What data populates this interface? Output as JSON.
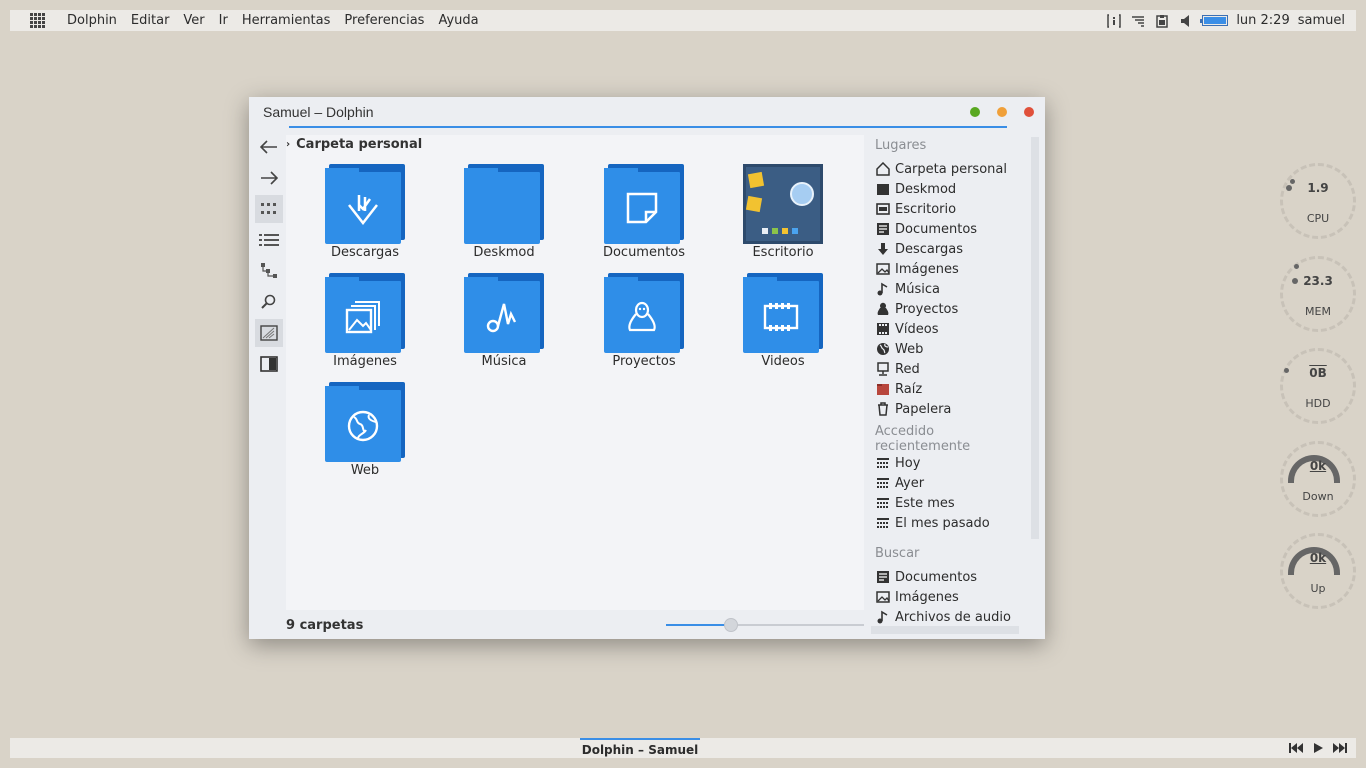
{
  "top_panel": {
    "menu": [
      "Dolphin",
      "Editar",
      "Ver",
      "Ir",
      "Herramientas",
      "Preferencias",
      "Ayuda"
    ],
    "tray_icons": [
      "info-icon",
      "notifications-icon",
      "clipboard-icon",
      "volume-icon",
      "battery-icon"
    ],
    "clock": "lun 2:29",
    "user": "samuel"
  },
  "window": {
    "title": "Samuel – Dolphin",
    "buttons": [
      {
        "name": "minimize",
        "color": "#59a821"
      },
      {
        "name": "maximize",
        "color": "#f0a03a"
      },
      {
        "name": "close",
        "color": "#e0503a"
      }
    ],
    "breadcrumb": "Carpeta personal",
    "toolbar": [
      "back-arrow-icon",
      "forward-arrow-icon",
      "icons-view-icon",
      "details-view-icon",
      "tree-view-icon",
      "search-icon",
      "preview-icon",
      "panel-icon"
    ],
    "items": [
      {
        "label": "Descargas",
        "icon": "download-icon"
      },
      {
        "label": "Deskmod",
        "icon": "none"
      },
      {
        "label": "Documentos",
        "icon": "document-icon"
      },
      {
        "label": "Escritorio",
        "icon": "desktop-icon"
      },
      {
        "label": "Imágenes",
        "icon": "images-icon"
      },
      {
        "label": "Música",
        "icon": "music-icon"
      },
      {
        "label": "Proyectos",
        "icon": "tux-icon"
      },
      {
        "label": "Videos",
        "icon": "film-icon"
      },
      {
        "label": "Web",
        "icon": "globe-icon"
      }
    ],
    "status": "9 carpetas",
    "zoom_fraction": 0.33
  },
  "places": {
    "lugares": {
      "title": "Lugares",
      "items": [
        {
          "label": "Carpeta personal",
          "icon": "home-icon"
        },
        {
          "label": "Deskmod",
          "icon": "folder-icon"
        },
        {
          "label": "Escritorio",
          "icon": "desktop-icon"
        },
        {
          "label": "Documentos",
          "icon": "document-icon"
        },
        {
          "label": "Descargas",
          "icon": "download-icon"
        },
        {
          "label": "Imágenes",
          "icon": "image-icon"
        },
        {
          "label": "Música",
          "icon": "music-icon"
        },
        {
          "label": "Proyectos",
          "icon": "tux-icon"
        },
        {
          "label": "Vídeos",
          "icon": "film-icon"
        },
        {
          "label": "Web",
          "icon": "globe-icon"
        },
        {
          "label": "Red",
          "icon": "network-icon"
        },
        {
          "label": "Raíz",
          "icon": "root-folder-icon"
        },
        {
          "label": "Papelera",
          "icon": "trash-icon"
        }
      ]
    },
    "recientes": {
      "title": "Accedido recientemente",
      "items": [
        {
          "label": "Hoy",
          "icon": "calendar-icon"
        },
        {
          "label": "Ayer",
          "icon": "calendar-icon"
        },
        {
          "label": "Este mes",
          "icon": "calendar-icon"
        },
        {
          "label": "El mes pasado",
          "icon": "calendar-icon"
        }
      ]
    },
    "buscar": {
      "title": "Buscar",
      "items": [
        {
          "label": "Documentos",
          "icon": "document-icon"
        },
        {
          "label": "Imágenes",
          "icon": "image-icon"
        },
        {
          "label": "Archivos de audio",
          "icon": "music-icon"
        }
      ]
    }
  },
  "gauges": [
    {
      "value": "1.9",
      "label": "CPU"
    },
    {
      "value": "23.3",
      "label": "MEM"
    },
    {
      "value": "0B",
      "label": "HDD"
    },
    {
      "value": "0k",
      "label": "Down"
    },
    {
      "value": "0k",
      "label": "Up"
    }
  ],
  "bottom_panel": {
    "task": "Dolphin – Samuel",
    "media": [
      "previous-icon",
      "play-icon",
      "next-icon"
    ]
  },
  "colors": {
    "accent": "#3a8ee6",
    "folder": "#2f8ee8",
    "folder_dark": "#1565c0",
    "desktop_bg": "#d9d3c8"
  }
}
